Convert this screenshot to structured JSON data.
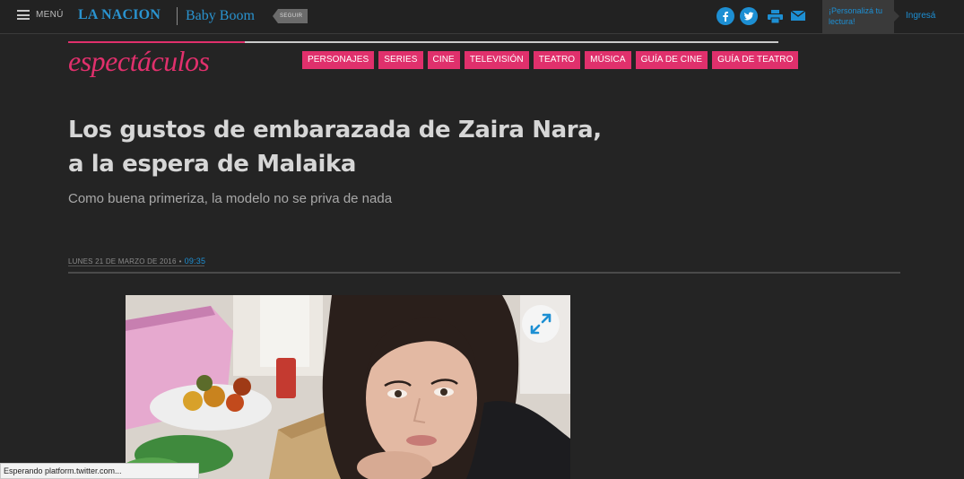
{
  "topbar": {
    "menu_label": "MENÚ",
    "brand": "LA NACION",
    "section_brand": "Baby Boom",
    "follow_label": "SEGUIR",
    "personaliza_text": "¡Personalizá tu lectura!",
    "login_label": "Ingresá",
    "icons": [
      "menu-icon",
      "facebook-icon",
      "twitter-icon",
      "print-icon",
      "mail-icon"
    ]
  },
  "section": {
    "title": "espectáculos",
    "nav": [
      "PERSONAJES",
      "SERIES",
      "CINE",
      "TELEVISIÓN",
      "TEATRO",
      "MÚSICA",
      "GUÍA DE CINE",
      "GUÍA DE TEATRO"
    ]
  },
  "article": {
    "headline": "Los gustos de embarazada de Zaira Nara, a la espera de Malaika",
    "subheadline": "Como buena primeriza, la modelo no se priva de nada",
    "date": "LUNES 21 DE MARZO DE 2016",
    "time": "09:35"
  },
  "status_bar": "Esperando platform.twitter.com...",
  "colors": {
    "background": "#242424",
    "accent_pink": "#e0306c",
    "link_blue": "#1d8fd3"
  }
}
